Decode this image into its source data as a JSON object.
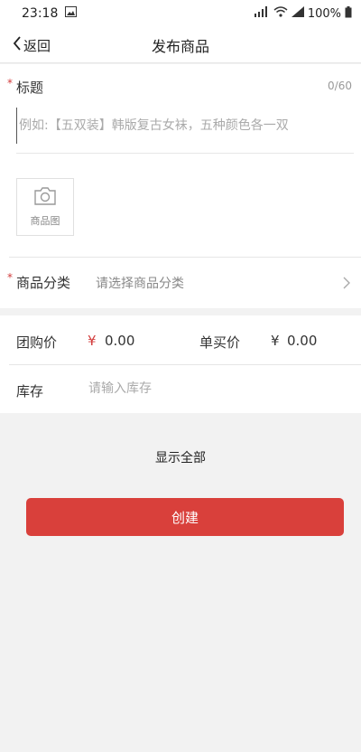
{
  "status_bar": {
    "time": "23:18",
    "battery": "100%"
  },
  "nav": {
    "back_label": "返回",
    "title": "发布商品"
  },
  "title_field": {
    "label": "标题",
    "counter": "0/60",
    "placeholder": "例如:【五双装】韩版复古女袜，五种颜色各一双"
  },
  "photo": {
    "label": "商品图"
  },
  "category": {
    "label": "商品分类",
    "placeholder": "请选择商品分类"
  },
  "pricing": {
    "group_label": "团购价",
    "group_currency": "¥",
    "group_value": "0.00",
    "single_label": "单买价",
    "single_currency": "¥",
    "single_value": "0.00"
  },
  "stock": {
    "label": "库存",
    "placeholder": "请输入库存"
  },
  "actions": {
    "show_all": "显示全部",
    "create": "创建"
  },
  "colors": {
    "accent": "#d9403b",
    "required_star": "#d23b3b",
    "background": "#f2f2f2"
  },
  "icons": [
    "image-icon",
    "wifi-icon",
    "signal-icon",
    "battery-icon",
    "back-chevron-icon",
    "camera-icon",
    "chevron-right-icon"
  ]
}
